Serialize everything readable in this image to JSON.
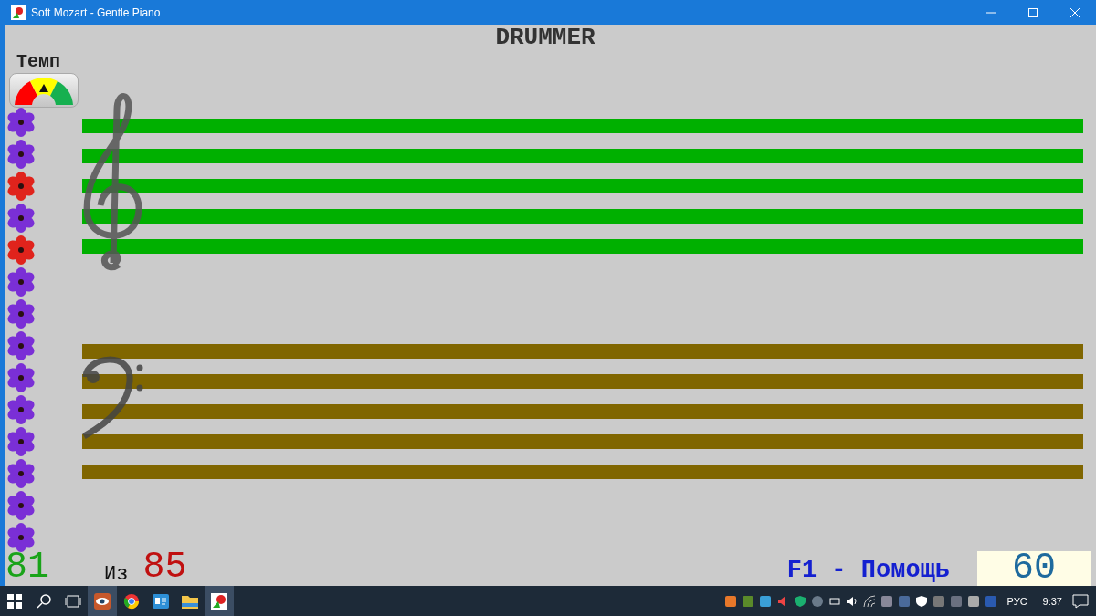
{
  "window": {
    "title": "Soft Mozart - Gentle Piano"
  },
  "header": {
    "title": "DRUMMER"
  },
  "tempo": {
    "label": "Темп"
  },
  "flowers": [
    {
      "color": "#7a2fd6"
    },
    {
      "color": "#7a2fd6"
    },
    {
      "color": "#e0231c"
    },
    {
      "color": "#7a2fd6"
    },
    {
      "color": "#e0231c"
    },
    {
      "color": "#7a2fd6"
    },
    {
      "color": "#7a2fd6"
    },
    {
      "color": "#7a2fd6"
    },
    {
      "color": "#7a2fd6"
    },
    {
      "color": "#7a2fd6"
    },
    {
      "color": "#7a2fd6"
    },
    {
      "color": "#7a2fd6"
    },
    {
      "color": "#7a2fd6"
    },
    {
      "color": "#7a2fd6"
    }
  ],
  "staves": [
    {
      "kind": "treble",
      "color": "#00b000"
    },
    {
      "kind": "bass",
      "color": "#806600"
    }
  ],
  "footer": {
    "score": "81",
    "of_label": "Из",
    "total": "85",
    "help": "F1 - Помощь",
    "tempo_value": "60"
  },
  "taskbar": {
    "language": "РУС",
    "time": "9:37"
  }
}
